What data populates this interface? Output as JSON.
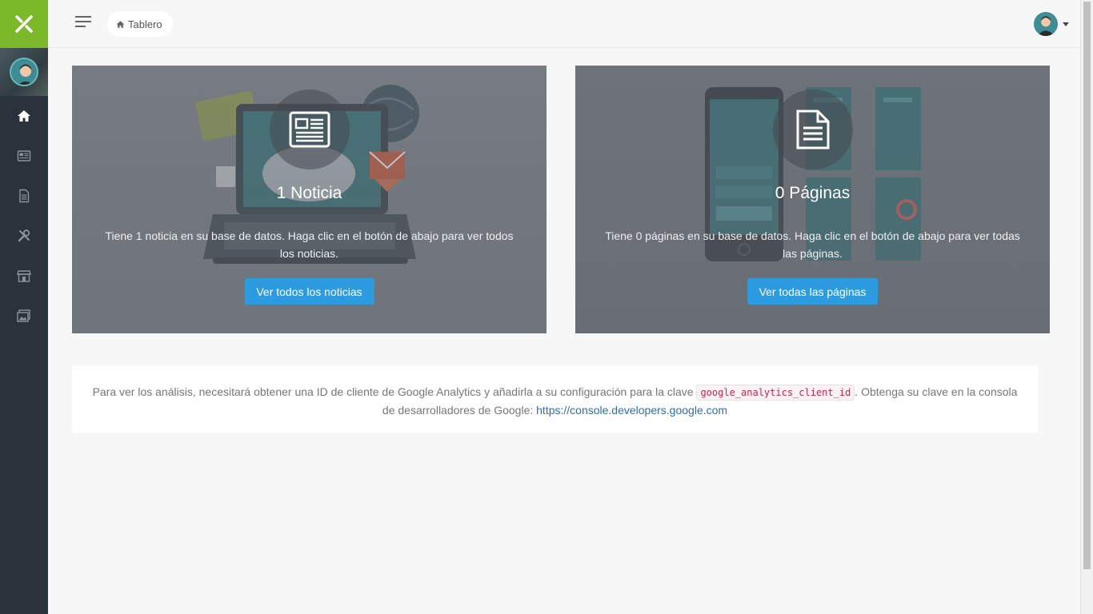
{
  "header": {
    "breadcrumb": "Tablero"
  },
  "sidebar": {
    "items": [
      {
        "icon": "home-icon",
        "active": true
      },
      {
        "icon": "newspaper-icon",
        "active": false
      },
      {
        "icon": "file-icon",
        "active": false
      },
      {
        "icon": "tools-icon",
        "active": false
      },
      {
        "icon": "store-icon",
        "active": false
      },
      {
        "icon": "images-icon",
        "active": false
      }
    ]
  },
  "cards": {
    "news": {
      "title": "1 Noticia",
      "text": "Tiene 1 noticia en su base de datos. Haga clic en el botón de abajo para ver todos los noticias.",
      "button": "Ver todos los noticias",
      "icon": "newspaper-icon"
    },
    "pages": {
      "title": "0 Páginas",
      "text": "Tiene 0 páginas en su base de datos. Haga clic en el botón de abajo para ver todas las páginas.",
      "button": "Ver todas las páginas",
      "icon": "file-icon"
    }
  },
  "analytics": {
    "text_before": "Para ver los análisis, necesitará obtener una ID de cliente de Google Analytics y añadirla a su configuración para la clave ",
    "code": "google_analytics_client_id",
    "text_after": ". Obtenga su clave en la consola de desarrolladores de Google: ",
    "link": "https://console.developers.google.com"
  },
  "colors": {
    "sidebar": "#2a323b",
    "logo": "#7bb92a",
    "button": "#2d9be0",
    "link": "#2a6fad"
  }
}
